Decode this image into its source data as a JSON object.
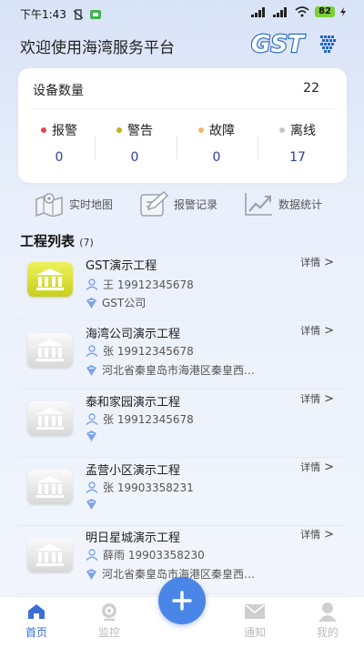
{
  "status_bar": {
    "time": "下午1:43",
    "battery": "82"
  },
  "header": {
    "title": "欢迎使用海湾服务平台",
    "brand": "GST"
  },
  "device_card": {
    "title": "设备数量",
    "count": "22",
    "stats": [
      {
        "label": "报警",
        "value": "0",
        "color": "#e2434b"
      },
      {
        "label": "警告",
        "value": "0",
        "color": "#c2b21a"
      },
      {
        "label": "故障",
        "value": "0",
        "color": "#f0b46a"
      },
      {
        "label": "离线",
        "value": "17",
        "color": "#c4c4c4"
      }
    ]
  },
  "quick_actions": [
    {
      "label": "实时地图",
      "icon": "map-icon"
    },
    {
      "label": "报警记录",
      "icon": "edit-icon"
    },
    {
      "label": "数据统计",
      "icon": "chart-icon"
    }
  ],
  "projects_section": {
    "title": "工程列表",
    "count": "(7)"
  },
  "projects": [
    {
      "name": "GST演示工程",
      "contact": "王 19912345678",
      "location": "GST公司",
      "detail": "详情",
      "active": true
    },
    {
      "name": "海湾公司演示工程",
      "contact": "张 19912345678",
      "location": "河北省秦皇岛市海港区秦皇西…",
      "detail": "详情",
      "active": false
    },
    {
      "name": "泰和家园演示工程",
      "contact": "张 19912345678",
      "location": "",
      "detail": "详情",
      "active": false
    },
    {
      "name": "孟营小区演示工程",
      "contact": "张 19903358231",
      "location": "",
      "detail": "详情",
      "active": false
    },
    {
      "name": "明日星城演示工程",
      "contact": "薛雨 19903358230",
      "location": "河北省秦皇岛市海港区秦皇西…",
      "detail": "详情",
      "active": false
    }
  ],
  "tabbar": {
    "items": [
      {
        "label": "首页",
        "icon": "home-icon",
        "active": true
      },
      {
        "label": "监控",
        "icon": "monitor-icon",
        "active": false
      },
      {
        "label": "通知",
        "icon": "mail-icon",
        "active": false
      },
      {
        "label": "我的",
        "icon": "user-icon",
        "active": false
      }
    ],
    "fab_icon": "plus-icon"
  },
  "colors": {
    "accent": "#3a6fd8",
    "brand": "#1e64c8",
    "value_text": "#2840a0"
  }
}
